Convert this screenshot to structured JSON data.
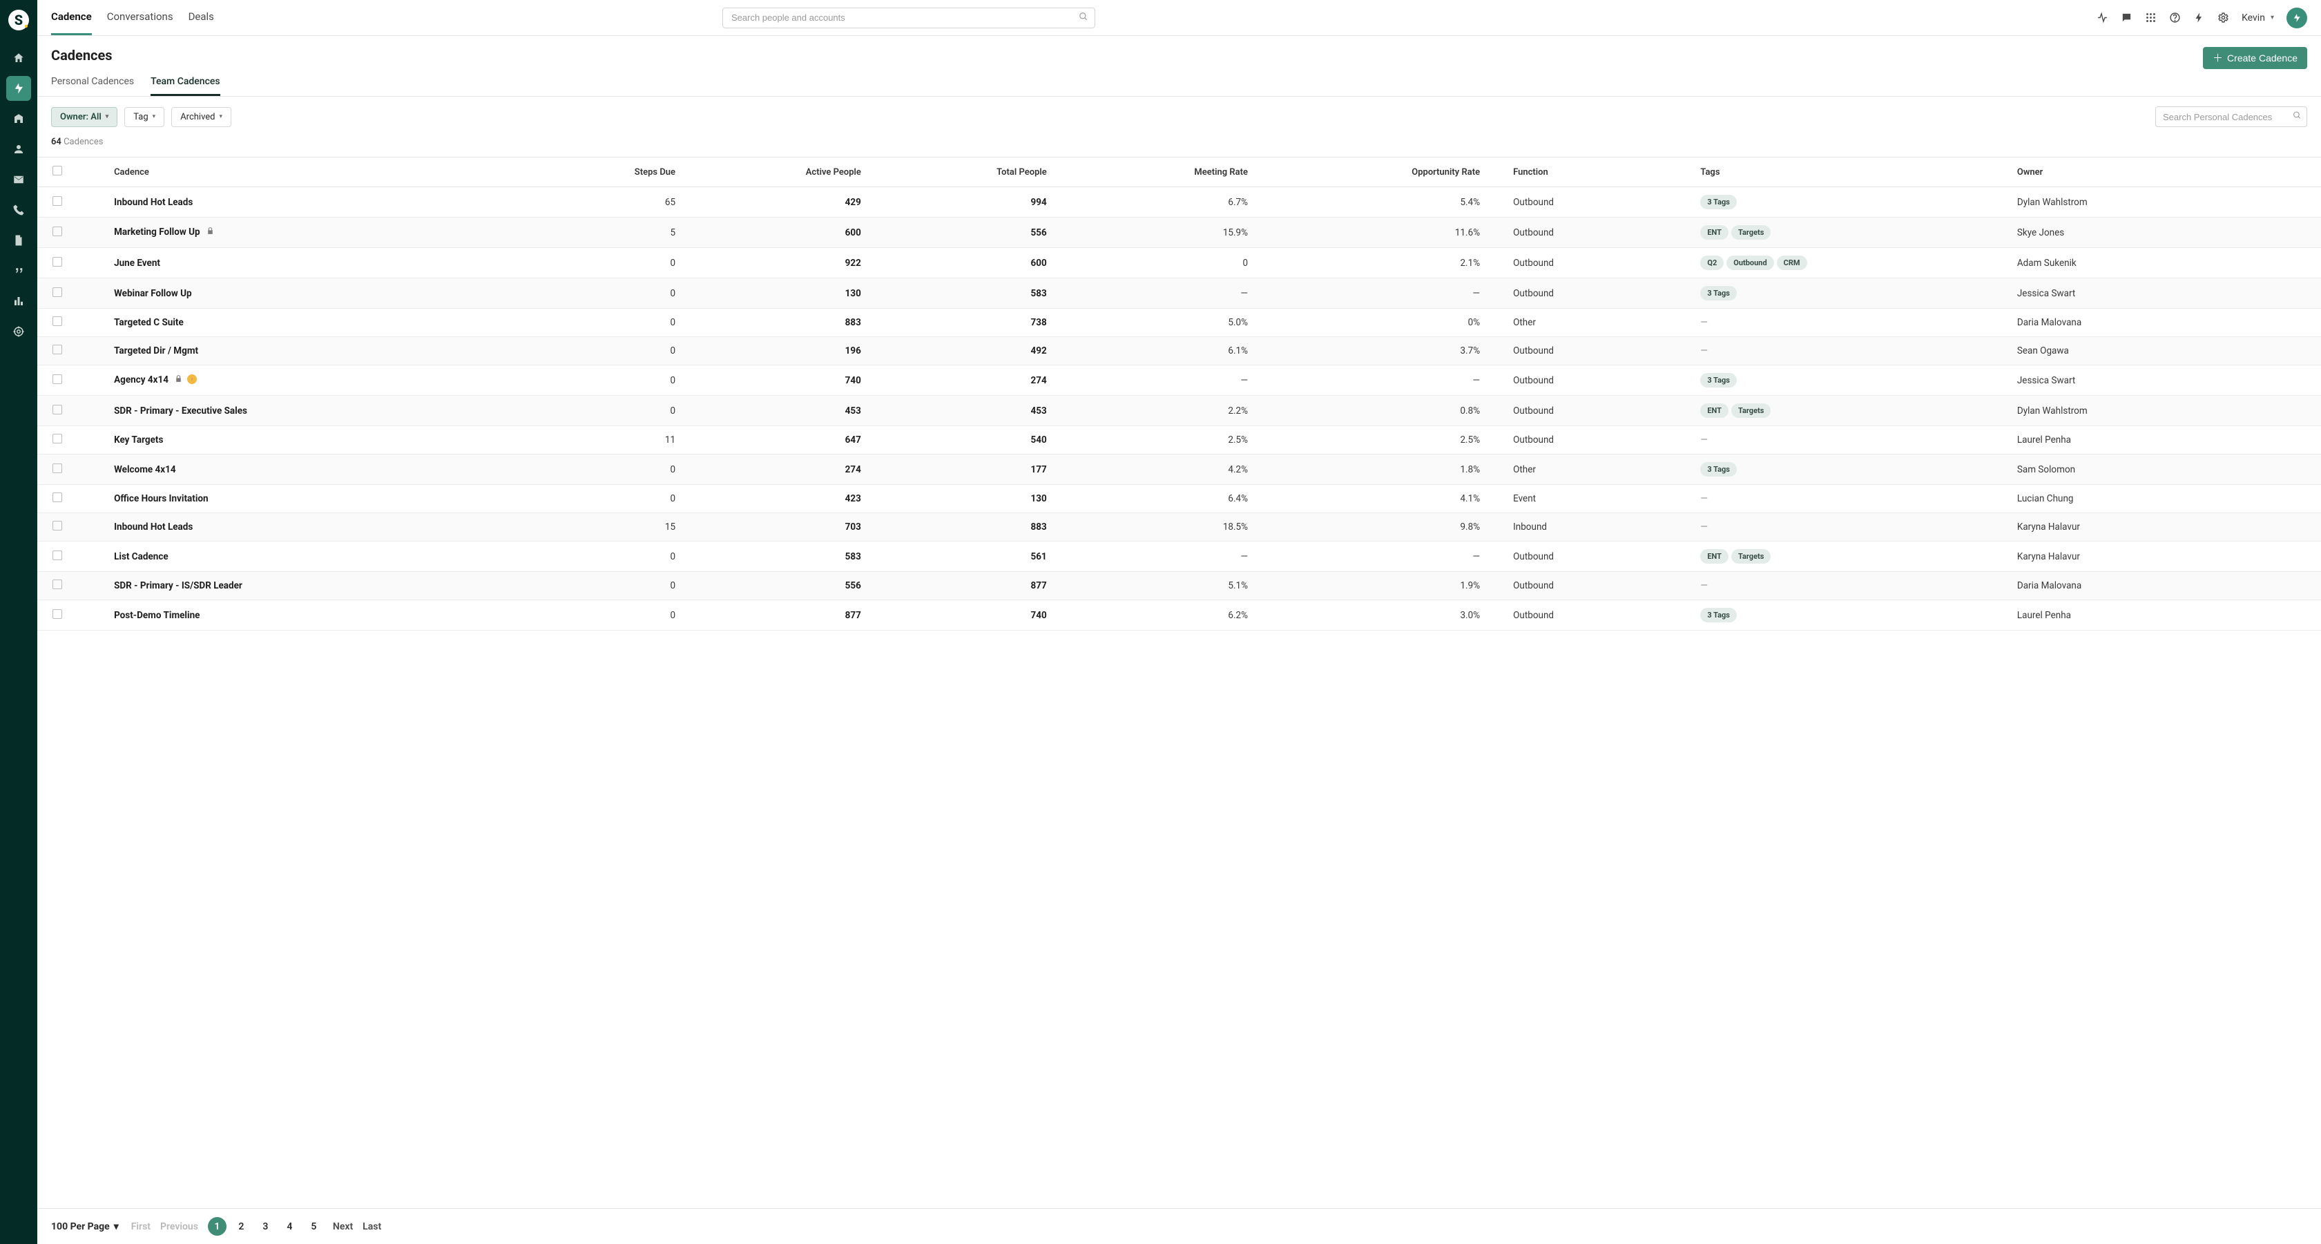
{
  "topnav": {
    "items": [
      {
        "label": "Cadence",
        "active": true
      },
      {
        "label": "Conversations",
        "active": false
      },
      {
        "label": "Deals",
        "active": false
      }
    ],
    "search_placeholder": "Search people and accounts",
    "user": "Kevin"
  },
  "page": {
    "title": "Cadences",
    "create_btn": "Create Cadence",
    "subtabs": [
      {
        "label": "Personal Cadences",
        "active": false
      },
      {
        "label": "Team Cadences",
        "active": true
      }
    ],
    "filters": {
      "owner_label": "Owner: All",
      "tag_label": "Tag",
      "archived_label": "Archived",
      "search_placeholder": "Search Personal Cadences"
    },
    "count": "64",
    "count_label": "Cadences"
  },
  "table": {
    "headers": [
      "Cadence",
      "Steps Due",
      "Active People",
      "Total People",
      "Meeting Rate",
      "Opportunity Rate",
      "Function",
      "Tags",
      "Owner"
    ],
    "rows": [
      {
        "name": "Inbound Hot Leads",
        "lock": false,
        "warn": false,
        "steps": "65",
        "active": "429",
        "total": "994",
        "meeting": "6.7%",
        "opp": "5.4%",
        "func": "Outbound",
        "tags": [
          "3 Tags"
        ],
        "owner": "Dylan Wahlstrom"
      },
      {
        "name": "Marketing Follow Up",
        "lock": true,
        "warn": false,
        "steps": "5",
        "active": "600",
        "total": "556",
        "meeting": "15.9%",
        "opp": "11.6%",
        "func": "Outbound",
        "tags": [
          "ENT",
          "Targets"
        ],
        "owner": "Skye Jones"
      },
      {
        "name": "June Event",
        "lock": false,
        "warn": false,
        "steps": "0",
        "active": "922",
        "total": "600",
        "meeting": "0",
        "opp": "2.1%",
        "func": "Outbound",
        "tags": [
          "Q2",
          "Outbound",
          "CRM"
        ],
        "owner": "Adam Sukenik"
      },
      {
        "name": "Webinar Follow Up",
        "lock": false,
        "warn": false,
        "steps": "0",
        "active": "130",
        "total": "583",
        "meeting": "—",
        "opp": "—",
        "func": "Outbound",
        "tags": [
          "3 Tags"
        ],
        "owner": "Jessica Swart"
      },
      {
        "name": "Targeted C Suite",
        "lock": false,
        "warn": false,
        "steps": "0",
        "active": "883",
        "total": "738",
        "meeting": "5.0%",
        "opp": "0%",
        "func": "Other",
        "tags": [
          "—"
        ],
        "owner": "Daria Malovana"
      },
      {
        "name": "Targeted Dir / Mgmt",
        "lock": false,
        "warn": false,
        "steps": "0",
        "active": "196",
        "total": "492",
        "meeting": "6.1%",
        "opp": "3.7%",
        "func": "Outbound",
        "tags": [
          "—"
        ],
        "owner": "Sean Ogawa"
      },
      {
        "name": "Agency 4x14",
        "lock": true,
        "warn": true,
        "steps": "0",
        "active": "740",
        "total": "274",
        "meeting": "—",
        "opp": "—",
        "func": "Outbound",
        "tags": [
          "3 Tags"
        ],
        "owner": "Jessica Swart"
      },
      {
        "name": "SDR - Primary - Executive Sales",
        "lock": false,
        "warn": false,
        "steps": "0",
        "active": "453",
        "total": "453",
        "meeting": "2.2%",
        "opp": "0.8%",
        "func": "Outbound",
        "tags": [
          "ENT",
          "Targets"
        ],
        "owner": "Dylan Wahlstrom"
      },
      {
        "name": "Key Targets",
        "lock": false,
        "warn": false,
        "steps": "11",
        "active": "647",
        "total": "540",
        "meeting": "2.5%",
        "opp": "2.5%",
        "func": "Outbound",
        "tags": [
          "—"
        ],
        "owner": "Laurel Penha"
      },
      {
        "name": "Welcome 4x14",
        "lock": false,
        "warn": false,
        "steps": "0",
        "active": "274",
        "total": "177",
        "meeting": "4.2%",
        "opp": "1.8%",
        "func": "Other",
        "tags": [
          "3 Tags"
        ],
        "owner": "Sam Solomon"
      },
      {
        "name": "Office Hours Invitation",
        "lock": false,
        "warn": false,
        "steps": "0",
        "active": "423",
        "total": "130",
        "meeting": "6.4%",
        "opp": "4.1%",
        "func": "Event",
        "tags": [
          "—"
        ],
        "owner": "Lucian Chung"
      },
      {
        "name": "Inbound Hot Leads",
        "lock": false,
        "warn": false,
        "steps": "15",
        "active": "703",
        "total": "883",
        "meeting": "18.5%",
        "opp": "9.8%",
        "func": "Inbound",
        "tags": [
          "—"
        ],
        "owner": "Karyna Halavur"
      },
      {
        "name": "List Cadence",
        "lock": false,
        "warn": false,
        "steps": "0",
        "active": "583",
        "total": "561",
        "meeting": "—",
        "opp": "—",
        "func": "Outbound",
        "tags": [
          "ENT",
          "Targets"
        ],
        "owner": "Karyna Halavur"
      },
      {
        "name": "SDR - Primary - IS/SDR Leader",
        "lock": false,
        "warn": false,
        "steps": "0",
        "active": "556",
        "total": "877",
        "meeting": "5.1%",
        "opp": "1.9%",
        "func": "Outbound",
        "tags": [
          "—"
        ],
        "owner": "Daria Malovana"
      },
      {
        "name": "Post-Demo Timeline",
        "lock": false,
        "warn": false,
        "steps": "0",
        "active": "877",
        "total": "740",
        "meeting": "6.2%",
        "opp": "3.0%",
        "func": "Outbound",
        "tags": [
          "3 Tags"
        ],
        "owner": "Laurel Penha"
      }
    ]
  },
  "pager": {
    "per_page": "100 Per Page",
    "first": "First",
    "prev": "Previous",
    "pages": [
      "1",
      "2",
      "3",
      "4",
      "5"
    ],
    "active_page": "1",
    "next": "Next",
    "last": "Last"
  }
}
